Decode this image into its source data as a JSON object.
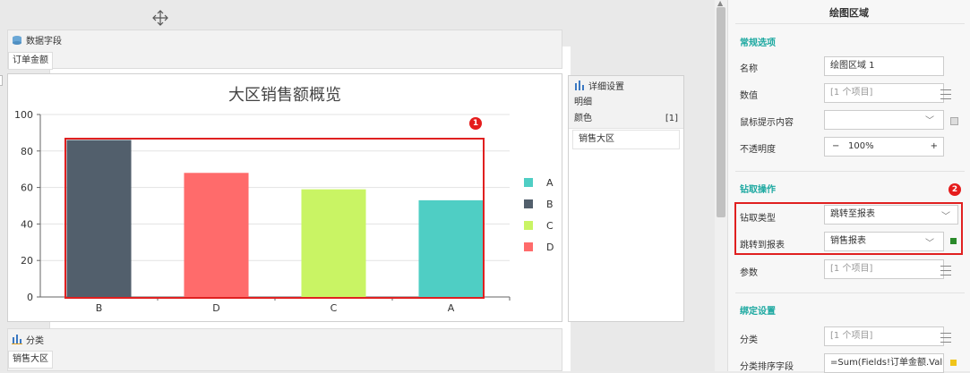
{
  "canvas": {
    "data_fields": {
      "title": "数据字段",
      "chip": "订单金额"
    },
    "category_zone": {
      "title": "分类",
      "chip": "销售大区"
    },
    "detail_panel": {
      "title": "详细设置",
      "section": "明细",
      "rows": [
        {
          "label": "颜色",
          "value": "[1]"
        },
        {
          "label": "销售大区",
          "value": ""
        }
      ]
    },
    "badge_1": "1"
  },
  "chart_data": {
    "type": "bar",
    "title": "大区销售额概览",
    "categories": [
      "B",
      "D",
      "C",
      "A"
    ],
    "values": [
      86,
      68,
      59,
      53
    ],
    "colors": [
      "#525f6c",
      "#ff6b6b",
      "#c9f464",
      "#4fcec4"
    ],
    "ylim": [
      0,
      100
    ],
    "yticks": [
      0,
      20,
      40,
      60,
      80,
      100
    ],
    "legend": [
      {
        "label": "A",
        "color": "#4fcec4"
      },
      {
        "label": "B",
        "color": "#525f6c"
      },
      {
        "label": "C",
        "color": "#c9f464"
      },
      {
        "label": "D",
        "color": "#ff6b6b"
      }
    ],
    "legend_position": "right"
  },
  "panel": {
    "title": "绘图区域",
    "general_section": "常规选项",
    "name_label": "名称",
    "name_value": "绘图区域 1",
    "value_label": "数值",
    "value_value": "[1 个项目]",
    "tooltip_label": "鼠标提示内容",
    "tooltip_value": "",
    "opacity_label": "不透明度",
    "opacity_value": "100%",
    "opacity_minus": "−",
    "opacity_plus": "+",
    "drill_section": "钻取操作",
    "badge_2": "2",
    "drill_type_label": "钻取类型",
    "drill_type_value": "跳转至报表",
    "drill_target_label": "跳转到报表",
    "drill_target_value": "销售报表",
    "params_label": "参数",
    "params_value": "[1 个项目]",
    "binding_section": "绑定设置",
    "category_label": "分类",
    "category_value": "[1 个项目]",
    "sort_label": "分类排序字段",
    "sort_value": "=Sum(Fields!订单金额.Valu"
  }
}
